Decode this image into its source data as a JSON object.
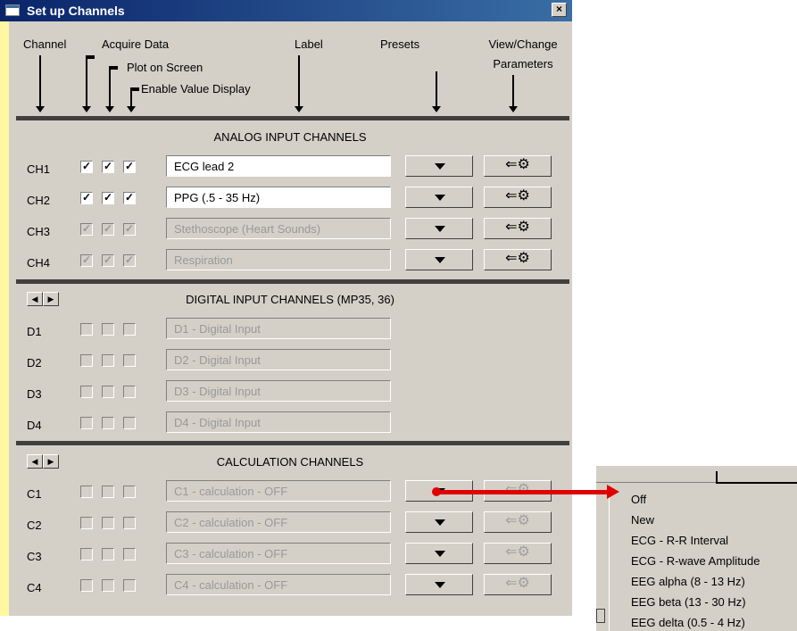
{
  "window": {
    "title": "Set up Channels",
    "close_label": "×"
  },
  "headers": {
    "channel": "Channel",
    "acquire": "Acquire Data",
    "plot": "Plot on Screen",
    "enable": "Enable Value Display",
    "label": "Label",
    "presets": "Presets",
    "view_change": "View/Change",
    "parameters": "Parameters"
  },
  "analog": {
    "heading": "ANALOG INPUT CHANNELS",
    "rows": [
      {
        "id": "CH1",
        "label": "ECG lead 2",
        "checks": [
          "✓",
          "✓",
          "✓"
        ]
      },
      {
        "id": "CH2",
        "label": "PPG (.5 - 35 Hz)",
        "checks": [
          "✓",
          "✓",
          "✓"
        ]
      },
      {
        "id": "CH3",
        "label": "Stethoscope (Heart Sounds)",
        "checks": [
          "✓",
          "✓",
          "✓"
        ]
      },
      {
        "id": "CH4",
        "label": "Respiration",
        "checks": [
          "✓",
          "✓",
          "✓"
        ]
      }
    ]
  },
  "digital": {
    "heading": "DIGITAL INPUT CHANNELS (MP35, 36)",
    "rows": [
      {
        "id": "D1",
        "label": "D1 - Digital Input"
      },
      {
        "id": "D2",
        "label": "D2 - Digital Input"
      },
      {
        "id": "D3",
        "label": "D3 - Digital Input"
      },
      {
        "id": "D4",
        "label": "D4 - Digital Input"
      }
    ]
  },
  "calc": {
    "heading": "CALCULATION CHANNELS",
    "rows": [
      {
        "id": "C1",
        "label": "C1 - calculation - OFF"
      },
      {
        "id": "C2",
        "label": "C2 - calculation - OFF"
      },
      {
        "id": "C3",
        "label": "C3 - calculation - OFF"
      },
      {
        "id": "C4",
        "label": "C4 - calculation - OFF"
      }
    ]
  },
  "nav": {
    "left": "◀",
    "right": "▶"
  },
  "wrench_glyph": "⇐⚙",
  "preset_menu": {
    "items": [
      "Off",
      "New",
      "ECG - R-R Interval",
      "ECG - R-wave  Amplitude",
      "EEG alpha (8 - 13 Hz)",
      "EEG beta (13 - 30 Hz)",
      "EEG delta (0.5 - 4 Hz)"
    ]
  },
  "colors": {
    "title_bar": "#0a246a",
    "callout_arrow": "#e00000",
    "left_strip": "#fff8a0"
  }
}
